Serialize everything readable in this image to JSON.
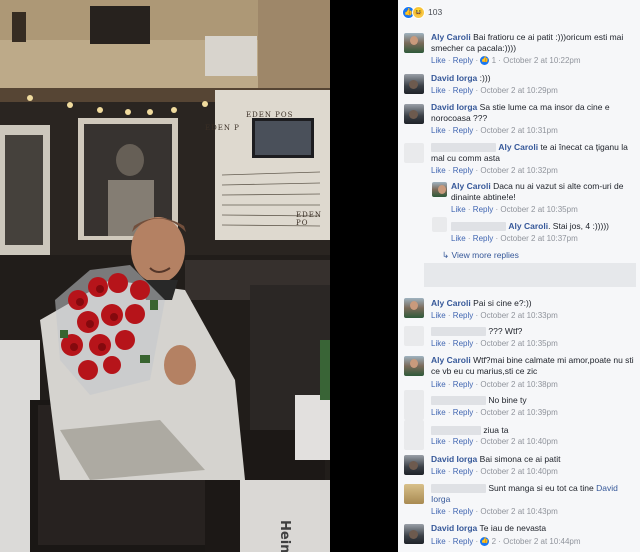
{
  "reactions": {
    "count": "103"
  },
  "comments": [
    {
      "author": "Aly Caroli",
      "text": "Bai fratioru ce ai patit :)))oricum esti mai smecher ca pacala:))))",
      "like": "Like",
      "reply": "Reply",
      "likes": "1",
      "time": "October 2 at 10:22pm"
    },
    {
      "author": "David Iorga",
      "text": ":)))",
      "like": "Like",
      "reply": "Reply",
      "time": "October 2 at 10:29pm"
    },
    {
      "author": "David Iorga",
      "text": "Sa stie lume ca ma insor da cine e norocoasa ???",
      "like": "Like",
      "reply": "Reply",
      "time": "October 2 at 10:31pm"
    },
    {
      "author": "Aly Caroli",
      "text_before": "te ai înecat ca țiganu la mal cu comm asta",
      "like": "Like",
      "reply": "Reply",
      "time": "October 2 at 10:32pm"
    },
    {
      "author": "Aly Caroli",
      "text": "Daca nu ai vazut si alte com-uri de dinainte abtine!e!",
      "like": "Like",
      "reply": "Reply",
      "time": "October 2 at 10:35pm"
    },
    {
      "author": "Aly Caroli",
      "text": ". Stai jos, 4 :)))))",
      "like": "Like",
      "reply": "Reply",
      "time": "October 2 at 10:37pm"
    },
    {
      "author": "Aly Caroli",
      "text": "Pai si cine e?:))",
      "like": "Like",
      "reply": "Reply",
      "time": "October 2 at 10:33pm"
    },
    {
      "text": "??? Wtf?",
      "like": "Like",
      "reply": "Reply",
      "time": "October 2 at 10:35pm"
    },
    {
      "author": "Aly Caroli",
      "text": "Wtf?mai bine calmate mi amor,poate nu sti ce vb eu cu marius,sti ce zic",
      "like": "Like",
      "reply": "Reply",
      "time": "October 2 at 10:38pm"
    },
    {
      "text": "No bine ty",
      "like": "Like",
      "reply": "Reply",
      "time": "October 2 at 10:39pm"
    },
    {
      "text": "ziua ta",
      "like": "Like",
      "reply": "Reply",
      "time": "October 2 at 10:40pm"
    },
    {
      "author": "David Iorga",
      "text": "Bai simona ce ai patit",
      "like": "Like",
      "reply": "Reply",
      "time": "October 2 at 10:40pm"
    },
    {
      "text": "Sunt manga si eu tot ca tine",
      "mention": "David Iorga",
      "like": "Like",
      "reply": "Reply",
      "time": "October 2 at 10:43pm"
    },
    {
      "author": "David Iorga",
      "text": "Te iau de nevasta",
      "like": "Like",
      "reply": "Reply",
      "likes": "2",
      "time": "October 2 at 10:44pm"
    }
  ],
  "view_more": "View more replies",
  "photo_signs": {
    "eden1": "EDEN P",
    "eden2": "EDEN POS",
    "eden3": "EDEN PO",
    "heineken": "Heineke"
  },
  "colors": {
    "link": "#365899",
    "meta": "#90949c",
    "panel": "#f6f7f9"
  }
}
